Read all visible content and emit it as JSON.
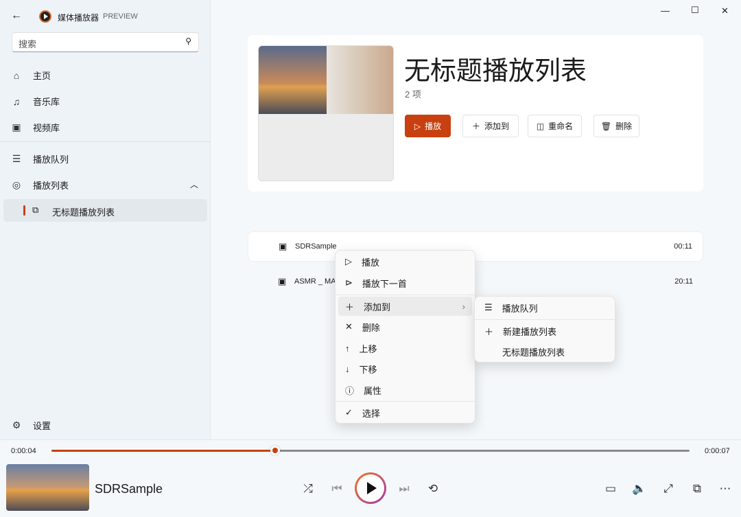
{
  "app": {
    "title": "媒体播放器",
    "badge": "PREVIEW"
  },
  "window": {
    "minimize": "—",
    "maximize": "☐",
    "close": "✕"
  },
  "search": {
    "placeholder": "搜索"
  },
  "sidebar": {
    "items": [
      {
        "label": "主页",
        "icon": "home-icon"
      },
      {
        "label": "音乐库",
        "icon": "music-icon"
      },
      {
        "label": "视频库",
        "icon": "video-icon"
      },
      {
        "label": "播放队列",
        "icon": "queue-icon"
      },
      {
        "label": "播放列表",
        "icon": "playlist-icon"
      }
    ],
    "sub_item": "无标题播放列表",
    "settings": "设置"
  },
  "playlist": {
    "title": "无标题播放列表",
    "count": "2 项",
    "buttons": {
      "play": "播放",
      "add": "添加到",
      "rename": "重命名",
      "delete": "删除"
    }
  },
  "tracks": [
    {
      "name": "SDRSample",
      "duration": "00:11"
    },
    {
      "name": "ASMR _ MA",
      "duration": "20:11"
    }
  ],
  "context_menu": {
    "items": [
      "播放",
      "播放下一首",
      "添加到",
      "删除",
      "上移",
      "下移",
      "属性",
      "选择"
    ]
  },
  "submenu": {
    "items": [
      "播放队列",
      "新建播放列表",
      "无标题播放列表"
    ]
  },
  "player": {
    "current_time": "0:00:04",
    "total_time": "0:00:07",
    "progress": 0.35,
    "title": "SDRSample"
  },
  "colors": {
    "accent": "#c8400f"
  }
}
